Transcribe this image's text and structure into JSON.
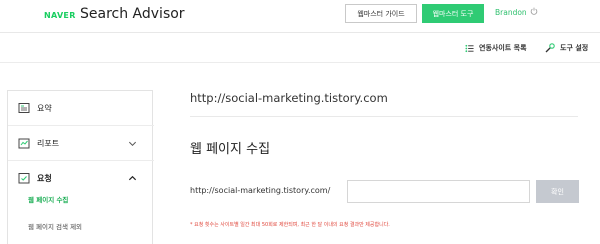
{
  "header": {
    "naver_logo": "NAVER",
    "brand_title": "Search Advisor",
    "guide_button": "웹마스터 가이드",
    "tools_button": "웹마스터 도구",
    "username": "Brandon"
  },
  "subbar": {
    "site_list": "연동사이트 목록",
    "tool_settings": "도구 설정"
  },
  "sidebar": {
    "summary": "요약",
    "report": "리포트",
    "request": "요청",
    "sub_items": [
      "웹 페이지 수집",
      "웹 페이지 검색 제외"
    ]
  },
  "main": {
    "site_url": "http://social-marketing.tistory.com",
    "section_title": "웹 페이지 수집",
    "url_prefix": "http://social-marketing.tistory.com/",
    "input_value": "",
    "confirm_button": "확인",
    "notice": "* 요청 횟수는 사이트별 일간 최대 50회로 제한되며, 최근 한 달 이내의 요청 결과만 제공합니다."
  },
  "colors": {
    "accent_green": "#2fcb74",
    "active_link": "#1cae55",
    "notice_red": "#e0463b"
  }
}
